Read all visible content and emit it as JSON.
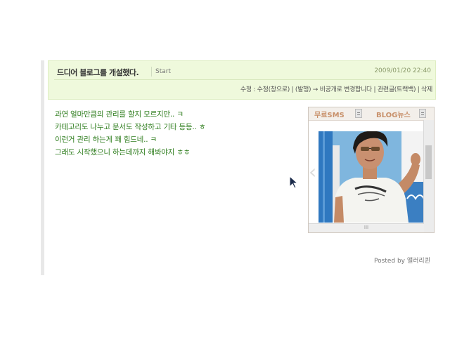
{
  "post": {
    "title": "드디어 블로그를 개설했다.",
    "category": "Start",
    "date": "2009/01/20 22:40",
    "actions": {
      "prefix": "수정 : ",
      "edit_window": "수정(창으로)",
      "sep1": " | ",
      "publish": "(발행) → 비공개로 변경합니다",
      "sep2": " | ",
      "related": "관련글(트랙백)",
      "sep3": " | ",
      "delete": "삭제"
    },
    "body_lines": [
      "과연 얼마만큼의 관리를 할지 모르지만.. ㅋ",
      "카테고리도 나누고 문서도 작성하고 기타 등등.. ㅎ",
      "이런거 관리 하는게 꽤 힘드네.. ㅋ",
      "그래도 시작했으니 하는데까지 해봐야지 ㅎㅎ"
    ],
    "posted_by": "Posted by 앨러리퀸"
  },
  "widget": {
    "tab1": "무료SMS",
    "tab2": "BLOG뉴스",
    "hscroll": "III",
    "arrow": "‹",
    "photo_icon": "person-photo"
  },
  "colors": {
    "header_bg": "#eff9dc",
    "body_text": "#2e7d1d",
    "tab_text": "#c8906a"
  }
}
